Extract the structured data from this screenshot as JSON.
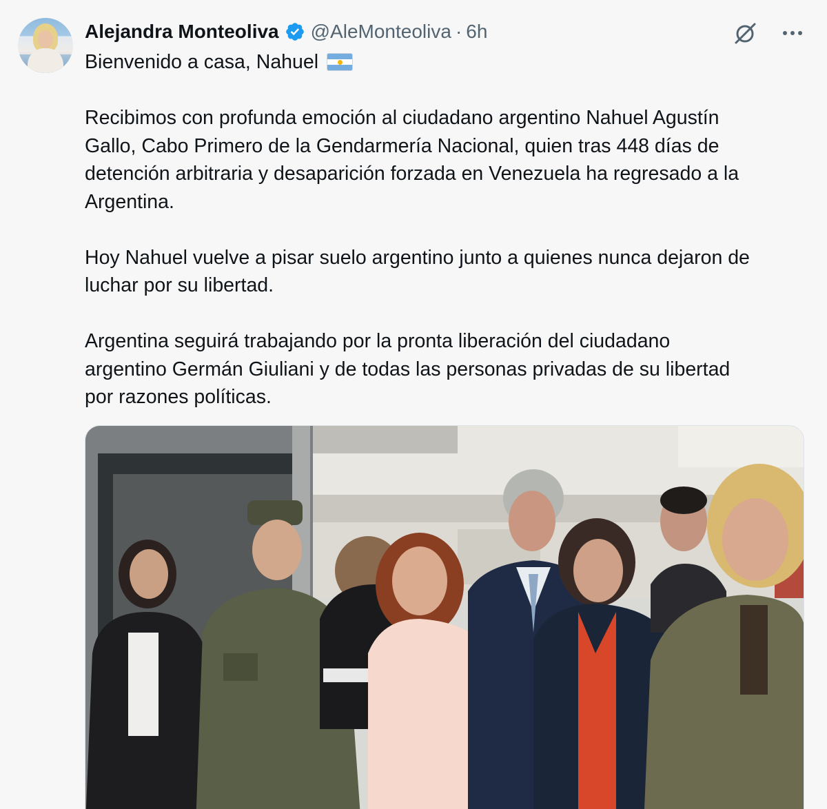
{
  "tweet": {
    "display_name": "Alejandra Monteoliva",
    "handle": "@AleMonteoliva",
    "separator": "·",
    "time": "6h",
    "first_line": "Bienvenido a casa, Nahuel",
    "paragraphs": [
      "Recibimos con profunda emoción al ciudadano argentino Nahuel Agustín",
      "Gallo, Cabo Primero de la Gendarmería Nacional, quien tras 448 días de",
      "detención arbitraria y desaparición forzada en Venezuela ha regresado a la",
      "Argentina.",
      "Hoy Nahuel vuelve a pisar suelo argentino junto a quienes nunca dejaron de",
      "luchar por su libertad.",
      "Argentina seguirá trabajando por la pronta liberación del ciudadano",
      "argentino Germán Giuliani y de todas las personas privadas de su libertad",
      "por razones políticas."
    ]
  },
  "icons": {
    "verified": "verified-badge-icon",
    "grok": "grok-icon",
    "more": "more-icon",
    "flag": "argentina-flag-icon"
  },
  "colors": {
    "verified_blue": "#1d9bf0",
    "text_primary": "#0f1419",
    "text_secondary": "#536471",
    "background": "#f7f7f8"
  }
}
